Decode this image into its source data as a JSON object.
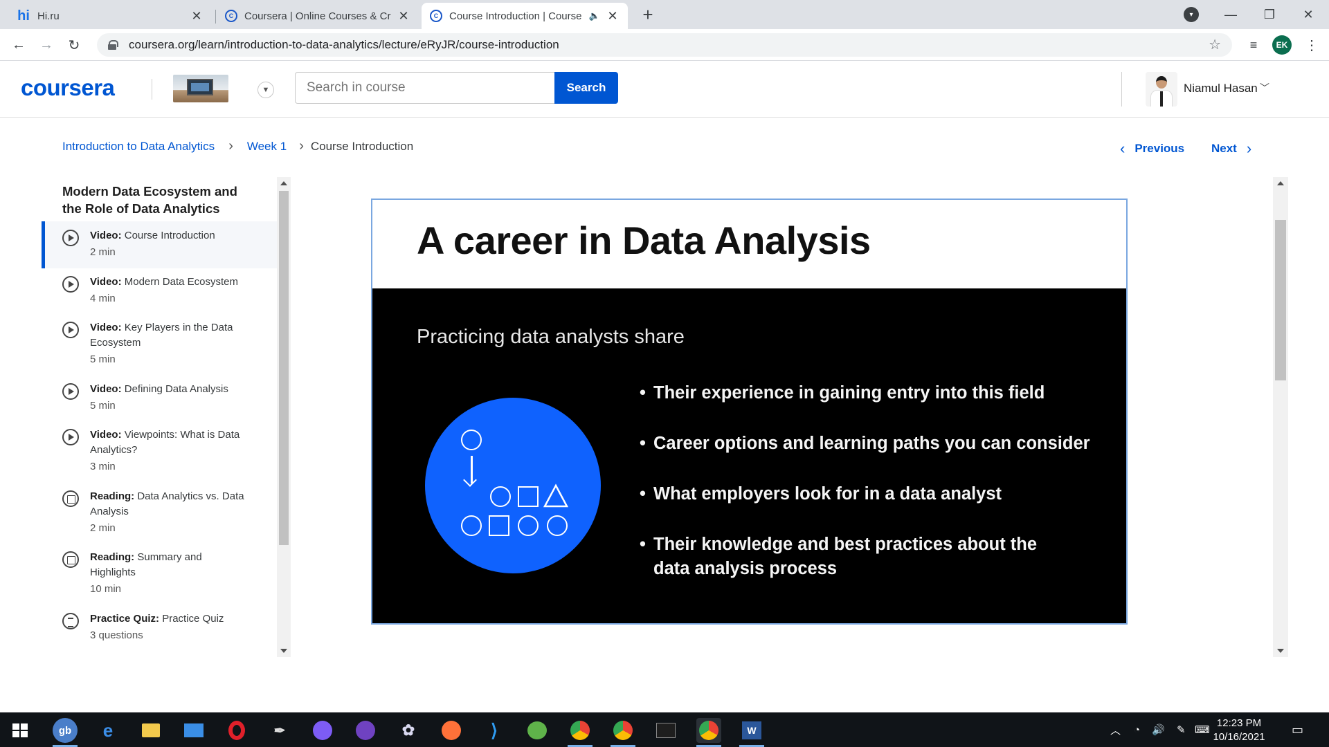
{
  "browser": {
    "tabs": [
      {
        "title": "Hi.ru",
        "favicon": "hi-icon",
        "active": false
      },
      {
        "title": "Coursera | Online Courses & Cred",
        "favicon": "coursera-icon",
        "active": false
      },
      {
        "title": "Course Introduction | Course",
        "favicon": "coursera-icon",
        "active": true,
        "audio": true
      }
    ],
    "url": "coursera.org/learn/introduction-to-data-analytics/lecture/eRyJR/course-introduction",
    "profile_initials": "EK"
  },
  "header": {
    "logo": "coursera",
    "search_placeholder": "Search in course",
    "search_button": "Search",
    "user_name": "Niamul Hasan"
  },
  "breadcrumb": {
    "items": [
      "Introduction to Data Analytics",
      "Week 1"
    ],
    "current": "Course Introduction",
    "previous": "Previous",
    "next": "Next"
  },
  "sidebar": {
    "week_title": "Modern Data Ecosystem and the Role of Data Analytics",
    "items": [
      {
        "type": "Video:",
        "title": "Course Introduction",
        "duration": "2 min",
        "icon": "play-icon",
        "active": true
      },
      {
        "type": "Video:",
        "title": "Modern Data Ecosystem",
        "duration": "4 min",
        "icon": "play-icon"
      },
      {
        "type": "Video:",
        "title": "Key Players in the Data Ecosystem",
        "duration": "5 min",
        "icon": "play-icon"
      },
      {
        "type": "Video:",
        "title": "Defining Data Analysis",
        "duration": "5 min",
        "icon": "play-icon"
      },
      {
        "type": "Video:",
        "title": "Viewpoints: What is Data Analytics?",
        "duration": "3 min",
        "icon": "play-icon"
      },
      {
        "type": "Reading:",
        "title": "Data Analytics vs. Data Analysis",
        "duration": "2 min",
        "icon": "reading-icon"
      },
      {
        "type": "Reading:",
        "title": "Summary and Highlights",
        "duration": "10 min",
        "icon": "reading-icon"
      },
      {
        "type": "Practice Quiz:",
        "title": "Practice Quiz",
        "duration": "3 questions",
        "icon": "quiz-icon"
      }
    ]
  },
  "slide": {
    "title": "A career in Data Analysis",
    "subtitle": "Practicing data analysts share",
    "bullets": [
      "Their experience in gaining entry into this field",
      "Career options and learning paths you can consider",
      "What employers look for in a data analyst",
      "Their knowledge and best practices about the data analysis process"
    ],
    "accent": "#0f62fe"
  },
  "taskbar": {
    "apps": [
      "windows-start",
      "gb-app",
      "edge",
      "file-explorer",
      "mail",
      "opera",
      "inkscape",
      "messenger",
      "github-desktop",
      "pinwheel-app",
      "firefox",
      "vscode",
      "earth-app",
      "chrome",
      "chrome-alt",
      "terminal",
      "chrome-profile-ek",
      "word"
    ],
    "time": "12:23 PM",
    "date": "10/16/2021"
  }
}
